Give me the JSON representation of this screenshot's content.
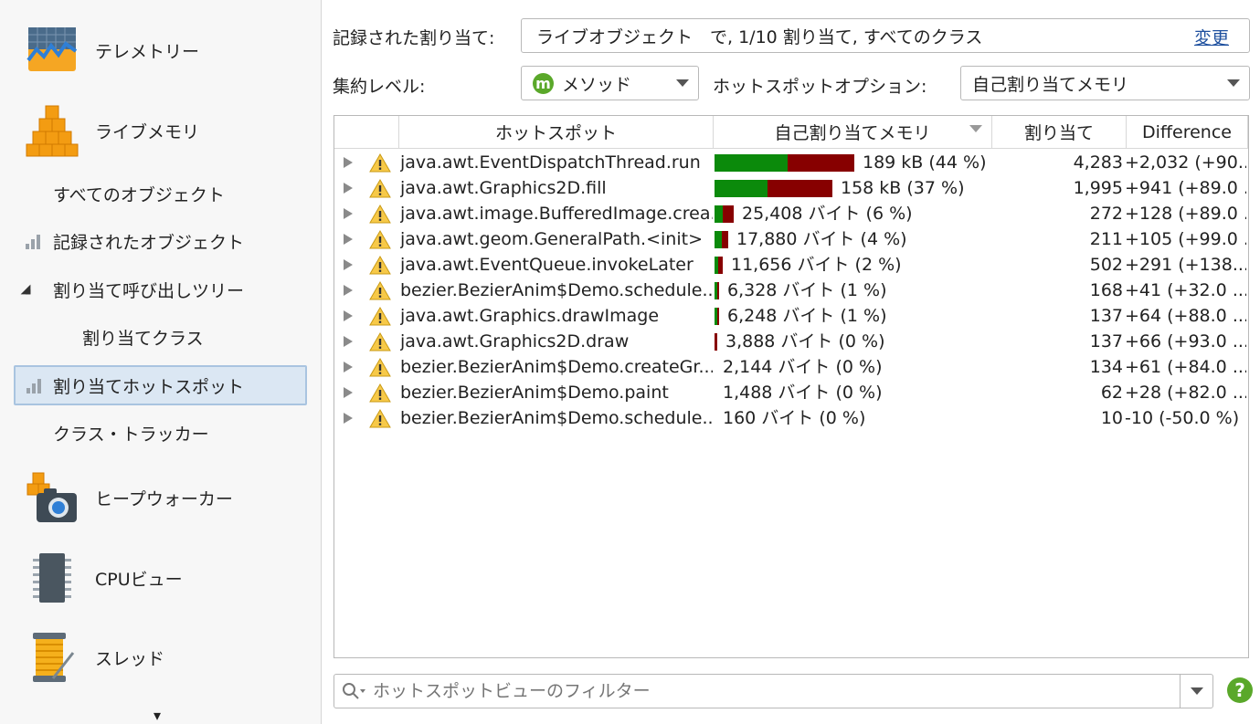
{
  "sidebar": {
    "telemetry": "テレメトリー",
    "live_memory": "ライブメモリ",
    "all_objects": "すべてのオブジェクト",
    "recorded_objects": "記録されたオブジェクト",
    "alloc_call_tree": "割り当て呼び出しツリー",
    "alloc_classes": "割り当てクラス",
    "alloc_hotspots": "割り当てホットスポット",
    "class_tracker": "クラス・トラッカー",
    "heap_walker": "ヒープウォーカー",
    "cpu_views": "CPUビュー",
    "threads": "スレッド",
    "more": "▾"
  },
  "controls": {
    "recorded_label": "記録された割り当て:",
    "recorded_value": "ライブオブジェクト　で, 1/10 割り当て, すべてのクラス",
    "change_link": "変更",
    "aggregation_label": "集約レベル:",
    "aggregation_badge": "m",
    "aggregation_value": "メソッド",
    "hotspot_option_label": "ホットスポットオプション:",
    "hotspot_option_value": "自己割り当てメモリ"
  },
  "table": {
    "headers": {
      "hotspot": "ホットスポット",
      "self_memory": "自己割り当てメモリ",
      "allocations": "割り当て",
      "difference": "Difference"
    },
    "rows": [
      {
        "name": "java.awt.EventDispatchThread.run",
        "mem": "189 kB (44 %)",
        "green": 0.52,
        "red": 0.48,
        "width": 1.0,
        "alloc": "4,283",
        "diff": "+2,032 (+90...."
      },
      {
        "name": "java.awt.Graphics2D.fill",
        "mem": "158 kB (37 %)",
        "green": 0.45,
        "red": 0.55,
        "width": 0.84,
        "alloc": "1,995",
        "diff": "+941 (+89.0 ..."
      },
      {
        "name": "java.awt.image.BufferedImage.crea...",
        "mem": "25,408 バイト (6 %)",
        "green": 0.45,
        "red": 0.55,
        "width": 0.14,
        "alloc": "272",
        "diff": "+128 (+89.0 ..."
      },
      {
        "name": "java.awt.geom.GeneralPath.<init>",
        "mem": "17,880 バイト (4 %)",
        "green": 0.55,
        "red": 0.45,
        "width": 0.095,
        "alloc": "211",
        "diff": "+105 (+99.0 ..."
      },
      {
        "name": "java.awt.EventQueue.invokeLater",
        "mem": "11,656 バイト (2 %)",
        "green": 0.45,
        "red": 0.55,
        "width": 0.06,
        "alloc": "502",
        "diff": "+291 (+138...."
      },
      {
        "name": "bezier.BezierAnim$Demo.schedule...",
        "mem": "6,328 バイト (1 %)",
        "green": 0.5,
        "red": 0.5,
        "width": 0.03,
        "alloc": "168",
        "diff": "+41 (+32.0 ..."
      },
      {
        "name": "java.awt.Graphics.drawImage",
        "mem": "6,248 バイト (1 %)",
        "green": 0.5,
        "red": 0.5,
        "width": 0.03,
        "alloc": "137",
        "diff": "+64 (+88.0 ..."
      },
      {
        "name": "java.awt.Graphics2D.draw",
        "mem": "3,888 バイト (0 %)",
        "green": 0.0,
        "red": 1.0,
        "width": 0.02,
        "alloc": "137",
        "diff": "+66 (+93.0 ..."
      },
      {
        "name": "bezier.BezierAnim$Demo.createGr...",
        "mem": "2,144 バイト (0 %)",
        "green": 0.0,
        "red": 0.0,
        "width": 0.0,
        "alloc": "134",
        "diff": "+61 (+84.0 ..."
      },
      {
        "name": "bezier.BezierAnim$Demo.paint",
        "mem": "1,488 バイト (0 %)",
        "green": 0.0,
        "red": 0.0,
        "width": 0.0,
        "alloc": "62",
        "diff": "+28 (+82.0 ..."
      },
      {
        "name": "bezier.BezierAnim$Demo.schedule...",
        "mem": "160 バイト (0 %)",
        "green": 0.0,
        "red": 0.0,
        "width": 0.0,
        "alloc": "10",
        "diff": "-10 (-50.0 %)"
      }
    ]
  },
  "filter": {
    "placeholder": "ホットスポットビューのフィルター",
    "help": "?"
  },
  "colors": {
    "bar_green": "#0b8a0b",
    "bar_red": "#870000",
    "selected_bg": "#dbe7f3",
    "link": "#1d4f9e"
  }
}
